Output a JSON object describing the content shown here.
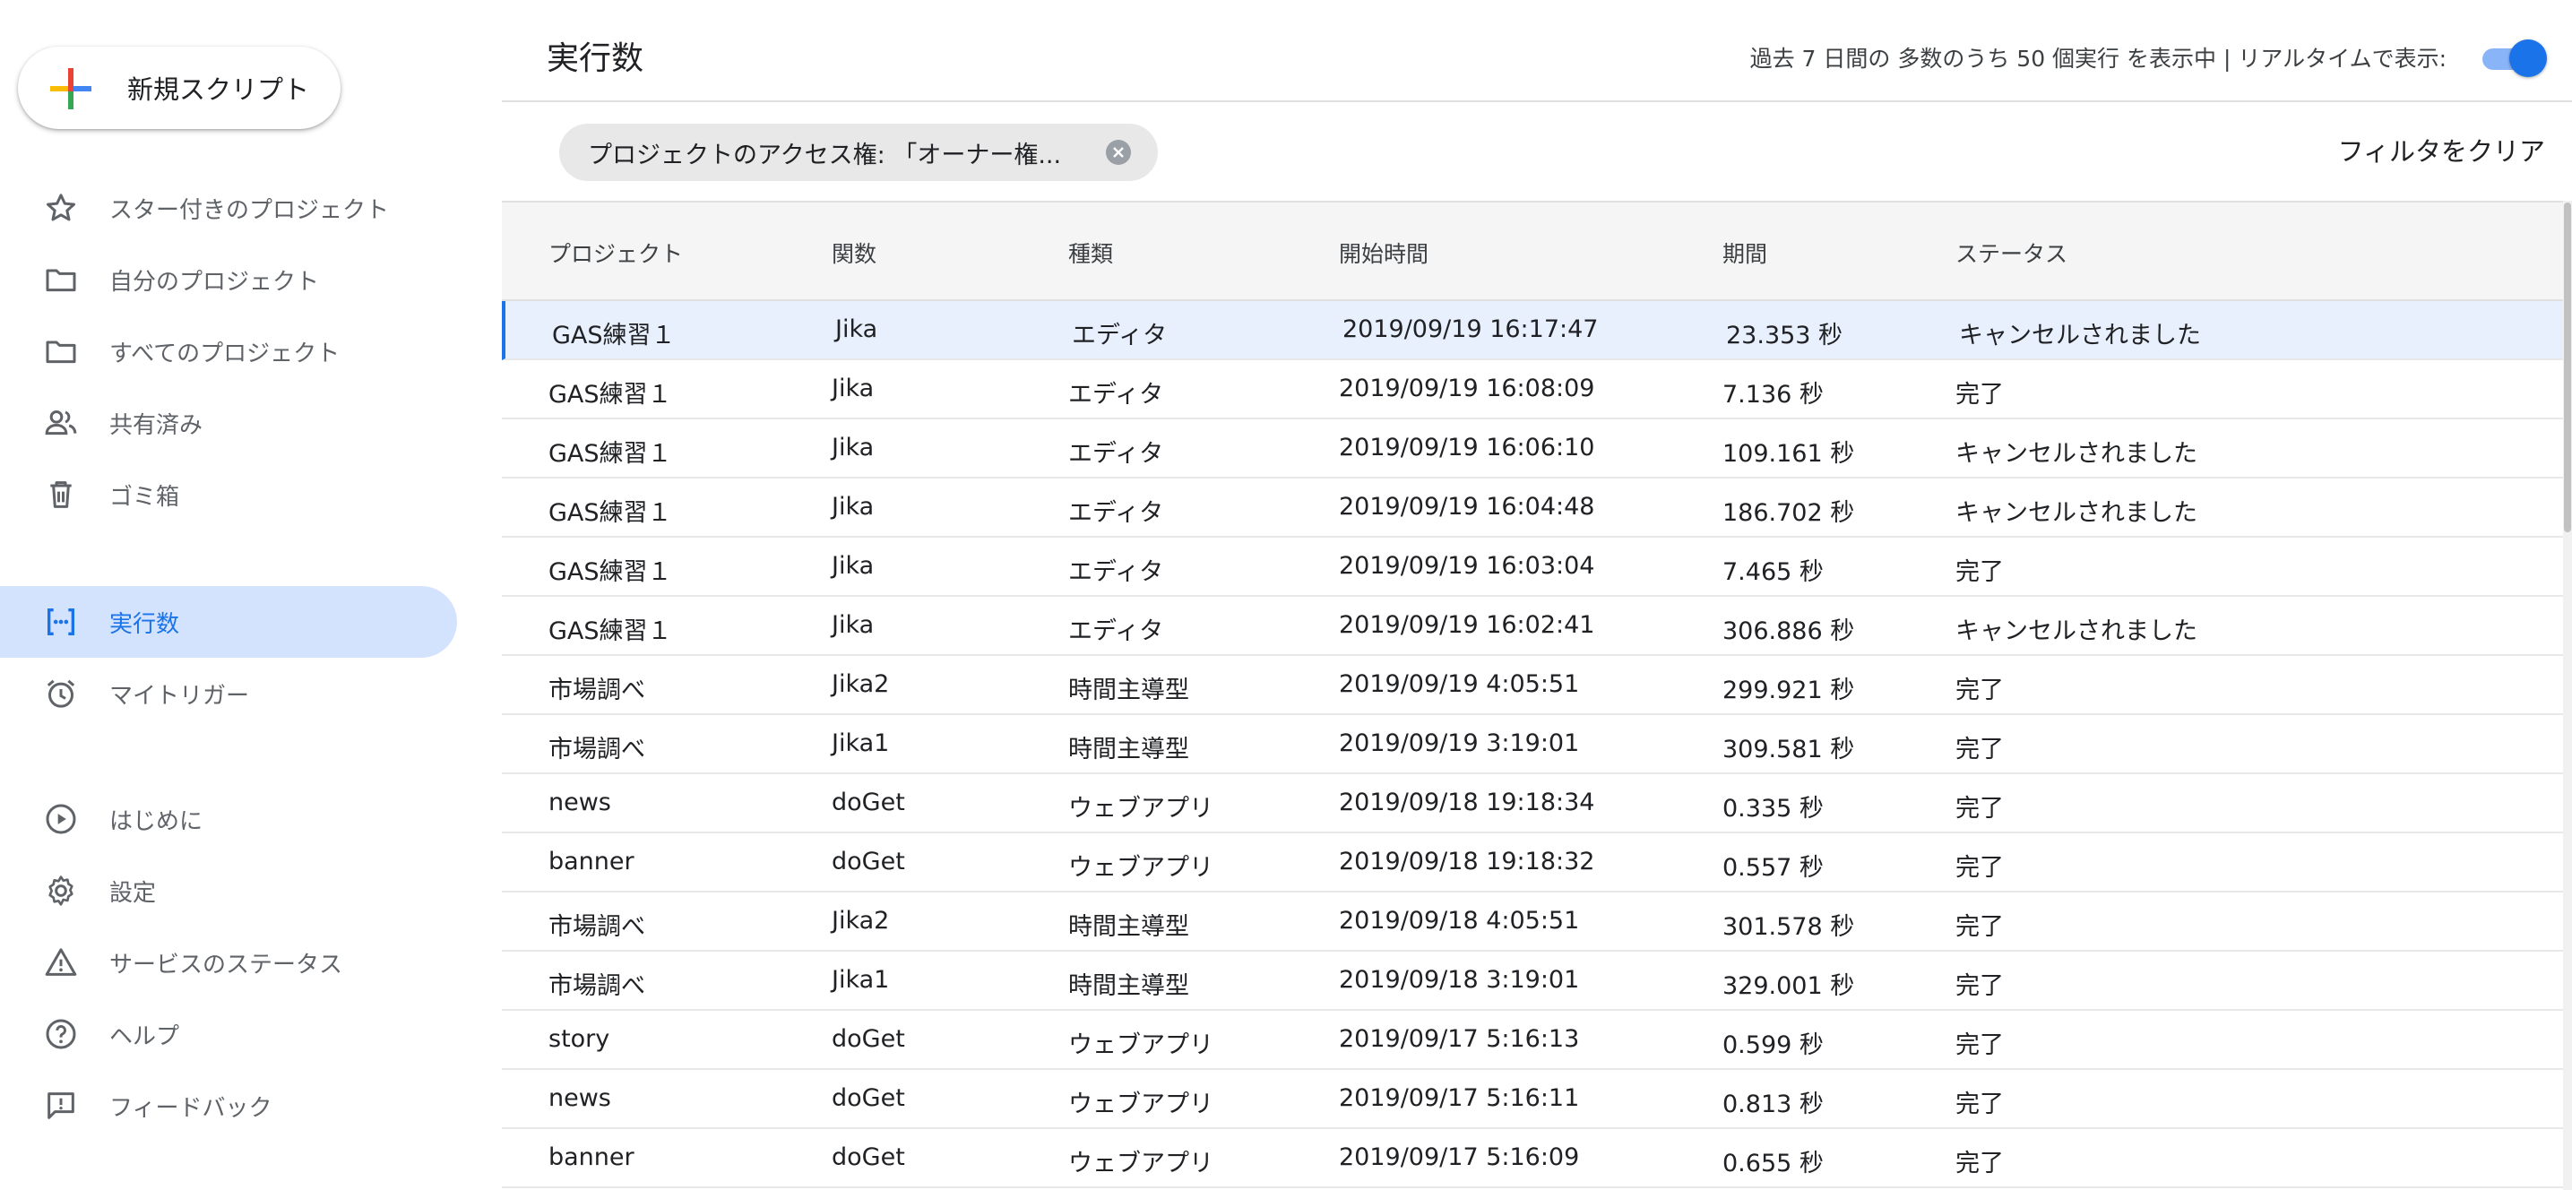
{
  "sidebar": {
    "new_script_label": "新規スクリプト",
    "items": [
      {
        "label": "スター付きのプロジェクト",
        "icon": "star-icon"
      },
      {
        "label": "自分のプロジェクト",
        "icon": "folder-icon"
      },
      {
        "label": "すべてのプロジェクト",
        "icon": "folder-icon"
      },
      {
        "label": "共有済み",
        "icon": "people-icon"
      },
      {
        "label": "ゴミ箱",
        "icon": "trash-icon"
      },
      {
        "label": "実行数",
        "icon": "executions-icon",
        "active": true
      },
      {
        "label": "マイトリガー",
        "icon": "alarm-icon"
      },
      {
        "label": "はじめに",
        "icon": "play-circle-icon"
      },
      {
        "label": "設定",
        "icon": "gear-icon"
      },
      {
        "label": "サービスのステータス",
        "icon": "warning-icon"
      },
      {
        "label": "ヘルプ",
        "icon": "help-icon"
      },
      {
        "label": "フィードバック",
        "icon": "feedback-icon"
      }
    ]
  },
  "header": {
    "title": "実行数",
    "info": "過去 7 日間の 多数のうち 50 個実行 を表示中  |  リアルタイムで表示:",
    "realtime_enabled": true
  },
  "filter": {
    "chip_label": "プロジェクトのアクセス権: 「オーナー権...",
    "clear_label": "フィルタをクリア"
  },
  "table": {
    "columns": [
      "プロジェクト",
      "関数",
      "種類",
      "開始時間",
      "期間",
      "ステータス"
    ],
    "rows": [
      [
        "GAS練習１",
        "Jika",
        "エディタ",
        "2019/09/19 16:17:47",
        "23.353 秒",
        "キャンセルされました"
      ],
      [
        "GAS練習１",
        "Jika",
        "エディタ",
        "2019/09/19 16:08:09",
        "7.136 秒",
        "完了"
      ],
      [
        "GAS練習１",
        "Jika",
        "エディタ",
        "2019/09/19 16:06:10",
        "109.161 秒",
        "キャンセルされました"
      ],
      [
        "GAS練習１",
        "Jika",
        "エディタ",
        "2019/09/19 16:04:48",
        "186.702 秒",
        "キャンセルされました"
      ],
      [
        "GAS練習１",
        "Jika",
        "エディタ",
        "2019/09/19 16:03:04",
        "7.465 秒",
        "完了"
      ],
      [
        "GAS練習１",
        "Jika",
        "エディタ",
        "2019/09/19 16:02:41",
        "306.886 秒",
        "キャンセルされました"
      ],
      [
        "市場調べ",
        "Jika2",
        "時間主導型",
        "2019/09/19 4:05:51",
        "299.921 秒",
        "完了"
      ],
      [
        "市場調べ",
        "Jika1",
        "時間主導型",
        "2019/09/19 3:19:01",
        "309.581 秒",
        "完了"
      ],
      [
        "news",
        "doGet",
        "ウェブアプリ",
        "2019/09/18 19:18:34",
        "0.335 秒",
        "完了"
      ],
      [
        "banner",
        "doGet",
        "ウェブアプリ",
        "2019/09/18 19:18:32",
        "0.557 秒",
        "完了"
      ],
      [
        "市場調べ",
        "Jika2",
        "時間主導型",
        "2019/09/18 4:05:51",
        "301.578 秒",
        "完了"
      ],
      [
        "市場調べ",
        "Jika1",
        "時間主導型",
        "2019/09/18 3:19:01",
        "329.001 秒",
        "完了"
      ],
      [
        "story",
        "doGet",
        "ウェブアプリ",
        "2019/09/17 5:16:13",
        "0.599 秒",
        "完了"
      ],
      [
        "news",
        "doGet",
        "ウェブアプリ",
        "2019/09/17 5:16:11",
        "0.813 秒",
        "完了"
      ],
      [
        "banner",
        "doGet",
        "ウェブアプリ",
        "2019/09/17 5:16:09",
        "0.655 秒",
        "完了"
      ]
    ]
  },
  "colors": {
    "accent": "#1a73e8",
    "active_nav_bg": "#d3e3fd",
    "selected_row_bg": "#e8f0fe"
  }
}
